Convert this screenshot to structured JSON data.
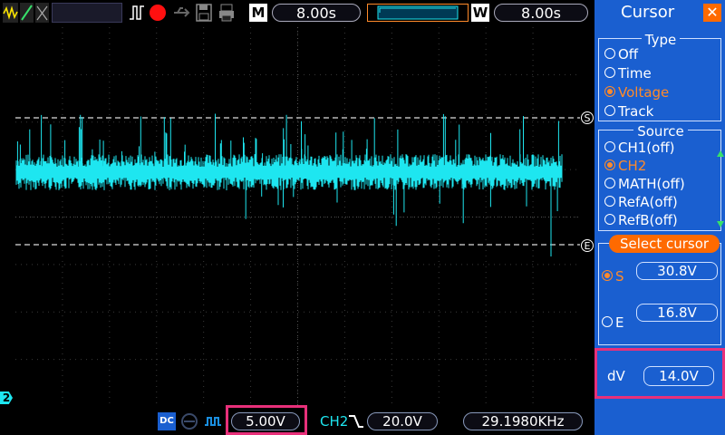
{
  "topbar": {
    "mode_label": "M",
    "time_base": "8.00s",
    "window_label": "W",
    "window_time": "8.00s"
  },
  "screen": {
    "channel_marker": "2",
    "cursor_s_label": "S",
    "cursor_e_label": "E"
  },
  "bottombar": {
    "coupling": "DC",
    "volts_div": "5.00V",
    "trigger_source": "CH2",
    "trigger_level": "20.0V",
    "frequency": "29.1980KHz"
  },
  "panel": {
    "title": "Cursor",
    "close_glyph": "✕",
    "type_group": {
      "title": "Type",
      "options": [
        "Off",
        "Time",
        "Voltage",
        "Track"
      ],
      "selected": "Voltage"
    },
    "source_group": {
      "title": "Source",
      "options": [
        "CH1(off)",
        "CH2",
        "MATH(off)",
        "RefA(off)",
        "RefB(off)"
      ],
      "selected": "CH2"
    },
    "select_cursor": {
      "title": "Select cursor",
      "s_label": "S",
      "s_value": "30.8V",
      "e_label": "E",
      "e_value": "16.8V"
    },
    "delta": {
      "label": "dV",
      "value": "14.0V"
    }
  },
  "colors": {
    "trace": "#1ee6f0",
    "panel_blue": "#1a5fd0",
    "accent_orange": "#ff6a00",
    "highlight_pink": "#e8307a"
  }
}
